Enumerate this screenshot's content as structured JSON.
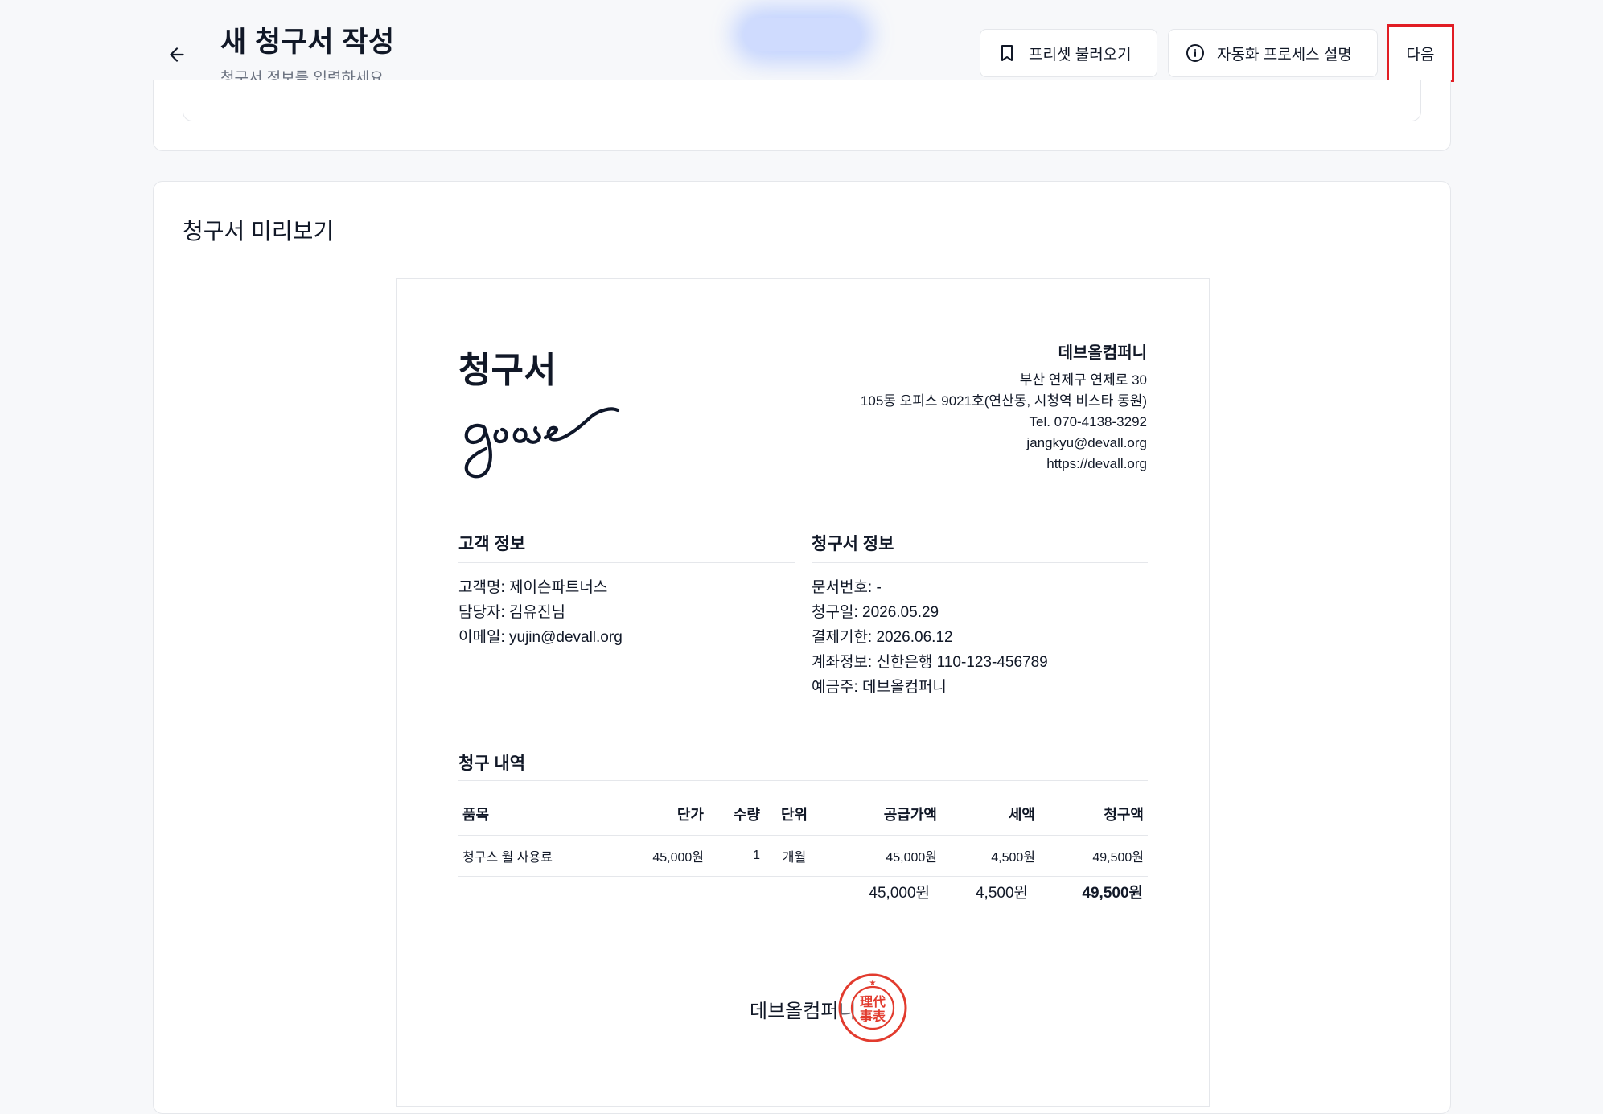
{
  "header": {
    "title": "새 청구서 작성",
    "subtitle": "청구서 정보를 입력하세요",
    "buttons": {
      "preset": "프리셋 불러오기",
      "auto": "자동화 프로세스 설명",
      "next": "다음"
    }
  },
  "preview": {
    "title": "청구서 미리보기"
  },
  "invoice": {
    "title": "청구서",
    "signature_text": "goose",
    "company": {
      "name": "데브올컴퍼니",
      "lines": [
        "부산 연제구 연제로 30",
        "105동 오피스 9021호(연산동, 시청역 비스타 동원)",
        "Tel. 070-4138-3292",
        "jangkyu@devall.org",
        "https://devall.org"
      ]
    },
    "customer": {
      "heading": "고객 정보",
      "rows": [
        {
          "k": "고객명:",
          "v": " 제이슨파트너스"
        },
        {
          "k": "담당자:",
          "v": " 김유진님"
        },
        {
          "k": "이메일:",
          "v": " yujin@devall.org"
        }
      ]
    },
    "doc": {
      "heading": "청구서 정보",
      "rows": [
        {
          "k": "문서번호:",
          "v": " -"
        },
        {
          "k": "청구일:",
          "v": " 2026.05.29"
        },
        {
          "k": "결제기한:",
          "v": " 2026.06.12"
        },
        {
          "k": "계좌정보:",
          "v": " 신한은행 110-123-456789"
        },
        {
          "k": "예금주:",
          "v": " 데브올컴퍼니"
        }
      ]
    },
    "items": {
      "heading": "청구 내역",
      "columns": [
        "품목",
        "단가",
        "수량",
        "단위",
        "공급가액",
        "세액",
        "청구액"
      ],
      "rows": [
        [
          "청구스 월 사용료",
          "45,000원",
          "1",
          "개월",
          "45,000원",
          "4,500원",
          "49,500원"
        ]
      ],
      "totals": {
        "supply": "45,000원",
        "tax": "4,500원",
        "total": "49,500원"
      }
    },
    "footer_company": "데브올컴퍼니",
    "seal_text": [
      "理代",
      "事表"
    ]
  },
  "colors": {
    "accent_highlight": "#e11d24",
    "seal": "#e23b2e"
  }
}
